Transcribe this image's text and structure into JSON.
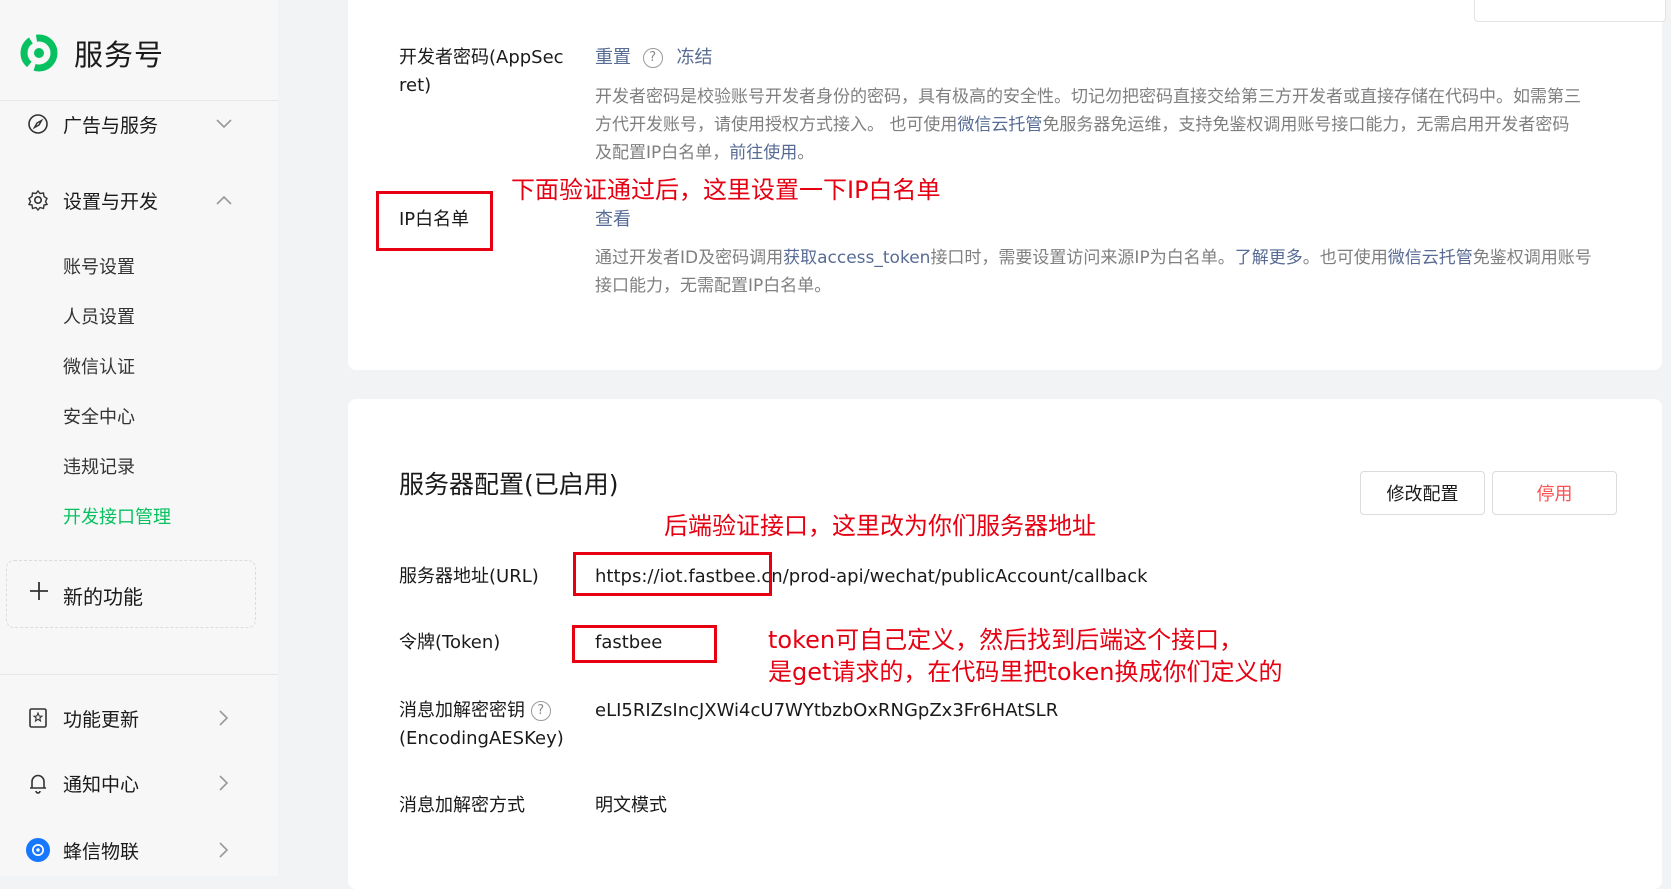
{
  "sidebar": {
    "brand": "服务号",
    "nav": {
      "ads": "广告与服务",
      "settings": "设置与开发",
      "sub": {
        "account": "账号设置",
        "people": "人员设置",
        "verify": "微信认证",
        "security": "安全中心",
        "violations": "违规记录",
        "devapi": "开发接口管理"
      },
      "new_feature": "新的功能",
      "updates": "功能更新",
      "notifications": "通知中心",
      "account_name": "蜂信物联"
    }
  },
  "secret": {
    "label_line1": "开发者密码(AppSec",
    "label_line2": "ret)",
    "reset": "重置",
    "help": "?",
    "freeze": "冻结",
    "desc_line1": "开发者密码是校验账号开发者身份的密码，具有极高的安全性。切记勿把密码直接交给第三方开发者或直接存储在代码中。如需第三",
    "desc_line2_a": "方代开发账号，请使用授权方式接入。 也可使用",
    "desc_line2_link": "微信云托管",
    "desc_line2_b": "免服务器免运维，支持免鉴权调用账号接口能力，无需启用开发者密码",
    "desc_line3_a": "及配置IP白名单，",
    "desc_line3_link": "前往使用",
    "desc_line3_b": "。"
  },
  "ip": {
    "label": "IP白名单",
    "view": "查看",
    "desc_line1_a": "通过开发者ID及密码调用",
    "desc_line1_link1": "获取access_token",
    "desc_line1_b": "接口时，需要设置访问来源IP为白名单。",
    "desc_line1_link2": "了解更多",
    "desc_line1_c": "。也可使用",
    "desc_line1_link3": "微信云托管",
    "desc_line1_d": "免鉴权调用账号",
    "desc_line2": "接口能力，无需配置IP白名单。"
  },
  "server": {
    "title": "服务器配置(已启用)",
    "modify_btn": "修改配置",
    "disable_btn": "停用",
    "url_label": "服务器地址(URL)",
    "url_value": "https://iot.fastbee.cn/prod-api/wechat/publicAccount/callback",
    "token_label": "令牌(Token)",
    "token_value": "fastbee",
    "aes_label_line1": "消息加解密密钥",
    "aes_help": "?",
    "aes_label_line2": "(EncodingAESKey)",
    "aes_value": "eLI5RIZsIncJXWi4cU7WYtbzbOxRNGpZx3Fr6HAtSLR",
    "mode_label": "消息加解密方式",
    "mode_value": "明文模式"
  },
  "annotations": {
    "ip_note": "下面验证通过后，这里设置一下IP白名单",
    "url_note": "后端验证接口，这里改为你们服务器地址",
    "token_note_line1": "token可自己定义，然后找到后端这个接口，",
    "token_note_line2": "是get请求的，在代码里把token换成你们定义的"
  },
  "colors": {
    "accent_green": "#07c160",
    "link_blue": "#576b95",
    "annotation_red": "#e60012",
    "danger_red": "#fa5151"
  }
}
